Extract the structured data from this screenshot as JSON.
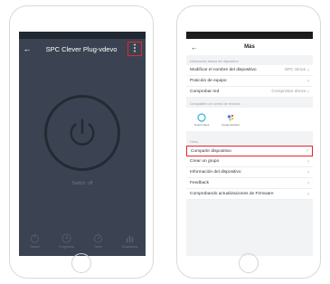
{
  "left_screen": {
    "title": "SPC Clever Plug-vdevo",
    "back_icon": "←",
    "menu_icon": "⋮",
    "switch_status": "Switch: off",
    "bottom_items": [
      {
        "label": "Switch",
        "icon": "power-icon"
      },
      {
        "label": "Programar",
        "icon": "clock-icon"
      },
      {
        "label": "Timer",
        "icon": "timer-icon"
      },
      {
        "label": "Estadística",
        "icon": "chart-icon"
      }
    ]
  },
  "right_screen": {
    "title": "Más",
    "back_icon": "←",
    "section_device_info": "Información básica del dispositivo",
    "rows_top": [
      {
        "label": "Modificar el nombre del dispositivo",
        "value": "SPC Sirius"
      },
      {
        "label": "Posición de equipo",
        "value": ""
      },
      {
        "label": "Comprobar red",
        "value": "Comprobar ahora"
      }
    ],
    "section_assistants": "Compatible con control de terceros",
    "assistants": [
      {
        "label": "Amazon Alexa",
        "icon": "alexa-icon"
      },
      {
        "label": "Google Assistant",
        "icon": "google-assistant-icon"
      }
    ],
    "section_other": "Otros",
    "rows_bottom": [
      {
        "label": "Compartir dispositivo"
      },
      {
        "label": "Crear un grupo"
      },
      {
        "label": "Información del dispositivo"
      },
      {
        "label": "Feedback"
      },
      {
        "label": "Comprobando actualizaciones de Firmware"
      }
    ],
    "chevron": "›"
  },
  "colors": {
    "highlight": "#e3262c",
    "dark_bg": "#3b4352",
    "light_bg": "#f2f3f5"
  }
}
